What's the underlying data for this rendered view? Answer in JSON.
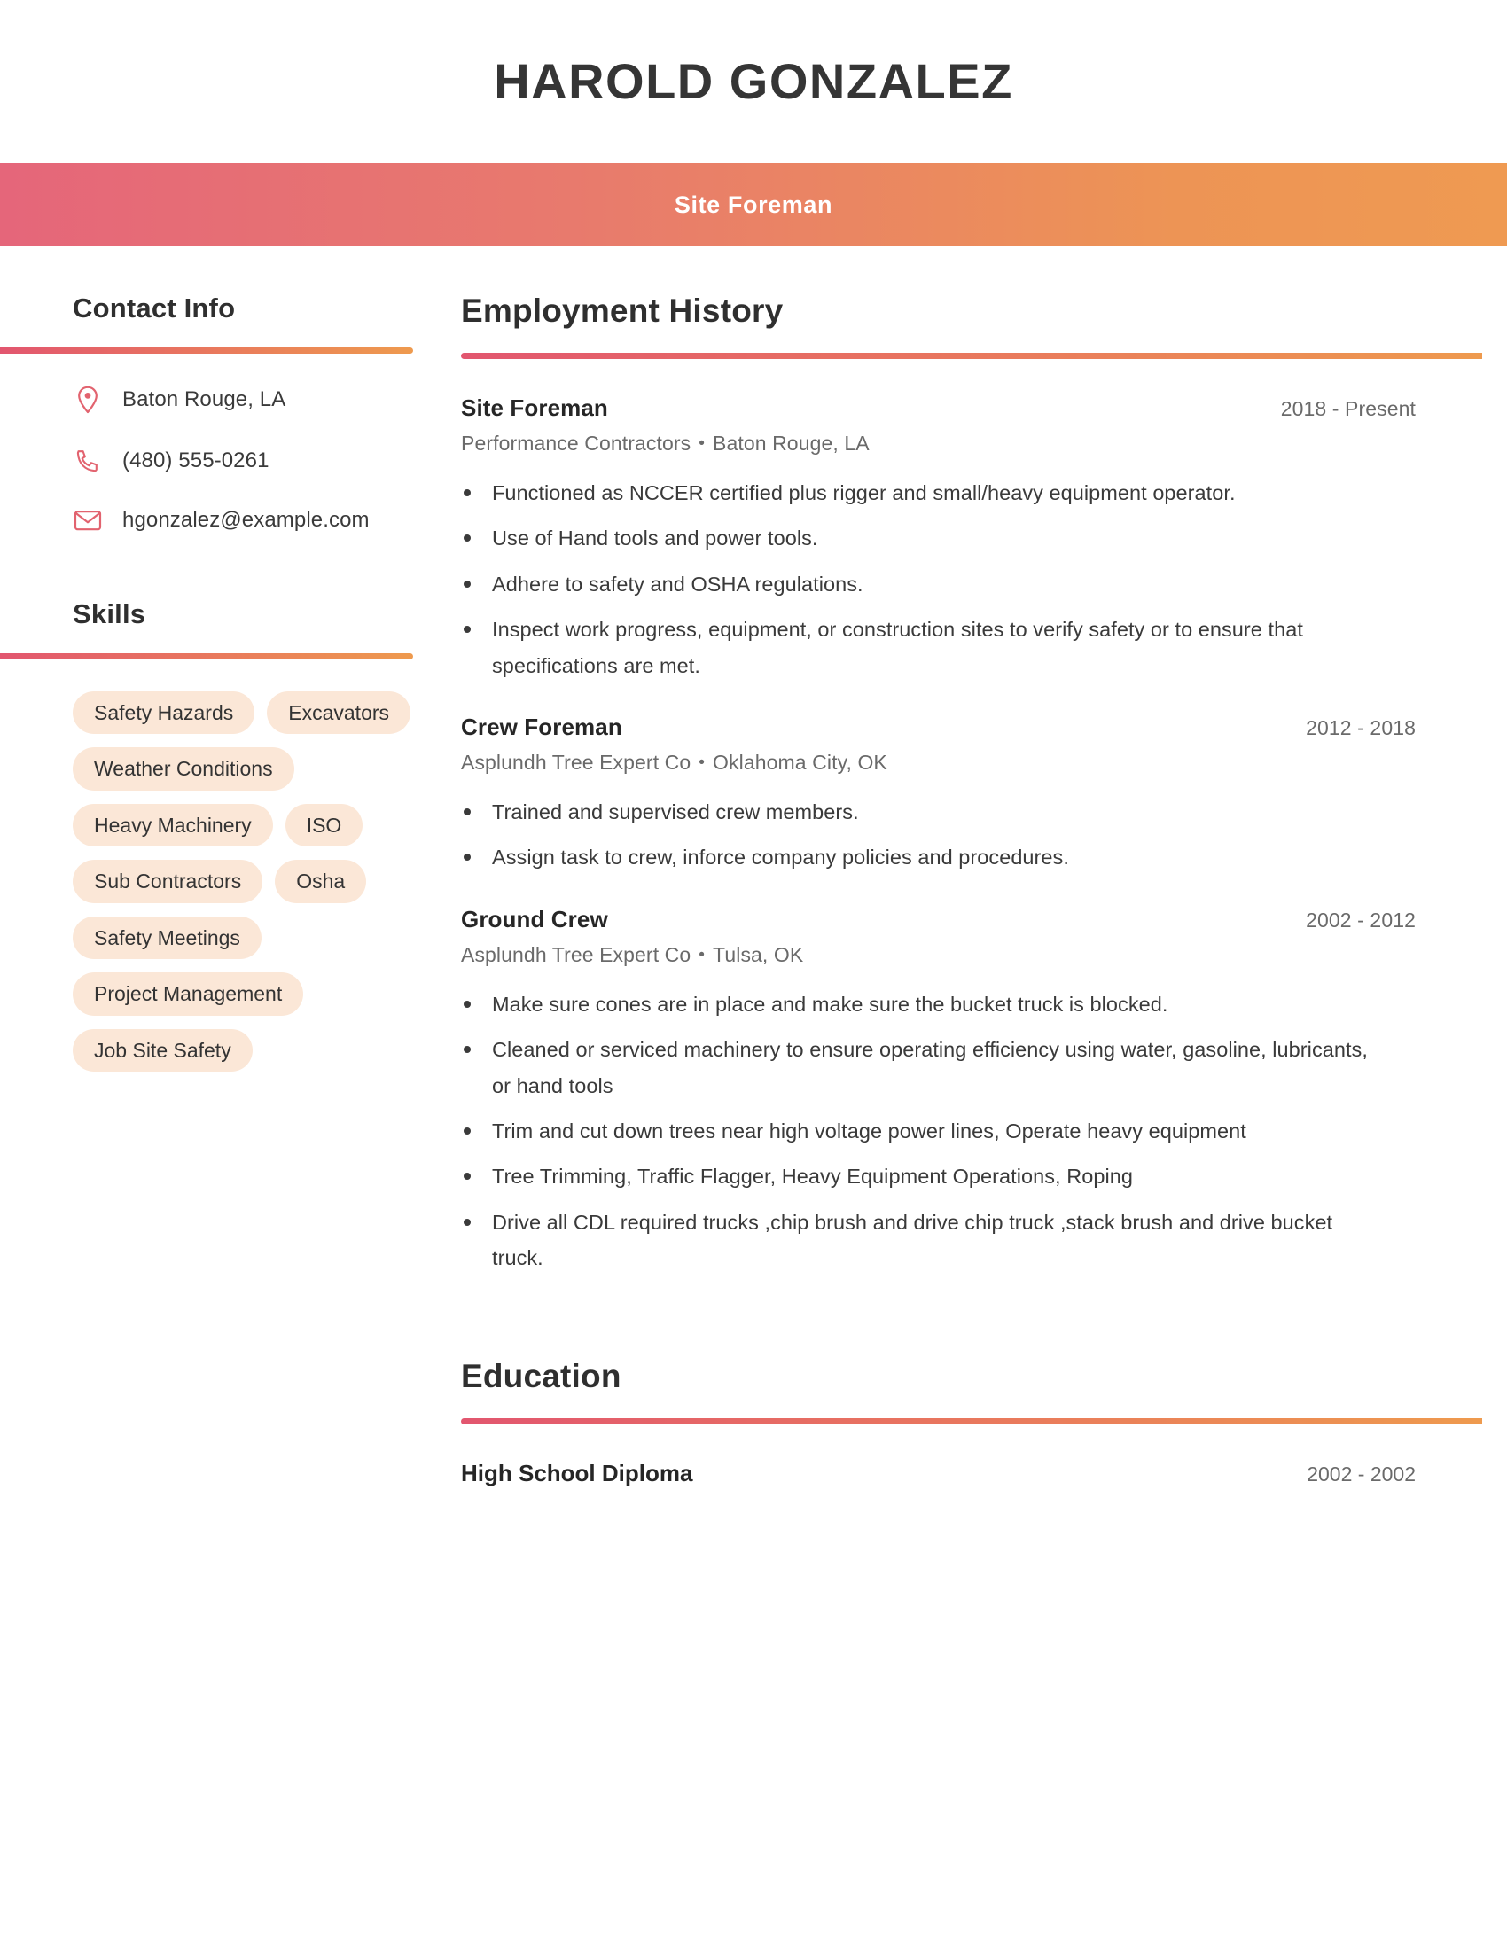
{
  "header": {
    "full_name": "HAROLD GONZALEZ",
    "job_title": "Site Foreman",
    "gradient_start": "#e5667a",
    "gradient_end": "#ef9a52"
  },
  "sidebar": {
    "contact": {
      "heading": "Contact Info",
      "items": [
        {
          "icon": "location-pin-icon",
          "value": "Baton Rouge, LA"
        },
        {
          "icon": "phone-icon",
          "value": "(480) 555-0261"
        },
        {
          "icon": "envelope-icon",
          "value": "hgonzalez@example.com"
        }
      ]
    },
    "skills": {
      "heading": "Skills",
      "chip_color": "#fbe7d7",
      "items": [
        "Safety Hazards",
        "Excavators",
        "Weather Conditions",
        "Heavy Machinery",
        "ISO",
        "Sub Contractors",
        "Osha",
        "Safety Meetings",
        "Project Management",
        "Job Site Safety"
      ]
    }
  },
  "main": {
    "employment": {
      "heading": "Employment History",
      "jobs": [
        {
          "role": "Site Foreman",
          "dates": "2018 - Present",
          "company": "Performance Contractors",
          "location": "Baton Rouge, LA",
          "bullets": [
            "Functioned as NCCER certified plus rigger and small/heavy equipment operator.",
            "Use of Hand tools and power tools.",
            "Adhere to safety and OSHA regulations.",
            "Inspect work progress, equipment, or construction sites to verify safety or to ensure that specifications are met."
          ]
        },
        {
          "role": "Crew Foreman",
          "dates": "2012 - 2018",
          "company": "Asplundh Tree Expert Co",
          "location": "Oklahoma City, OK",
          "bullets": [
            "Trained and supervised crew members.",
            "Assign task to crew, inforce company policies and procedures."
          ]
        },
        {
          "role": "Ground Crew",
          "dates": "2002 - 2012",
          "company": "Asplundh Tree Expert Co",
          "location": "Tulsa, OK",
          "bullets": [
            "Make sure cones are in place and make sure the bucket truck is blocked.",
            "Cleaned or serviced machinery to ensure operating efficiency using water, gasoline, lubricants, or hand tools",
            "Trim and cut down trees near high voltage power lines, Operate heavy equipment",
            "Tree Trimming, Traffic Flagger, Heavy Equipment Operations, Roping",
            "Drive all CDL required trucks ,chip brush and drive chip truck ,stack brush and drive bucket truck."
          ]
        }
      ]
    },
    "education": {
      "heading": "Education",
      "entries": [
        {
          "degree": "High School Diploma",
          "dates": "2002 - 2002"
        }
      ]
    },
    "separator": "•"
  }
}
